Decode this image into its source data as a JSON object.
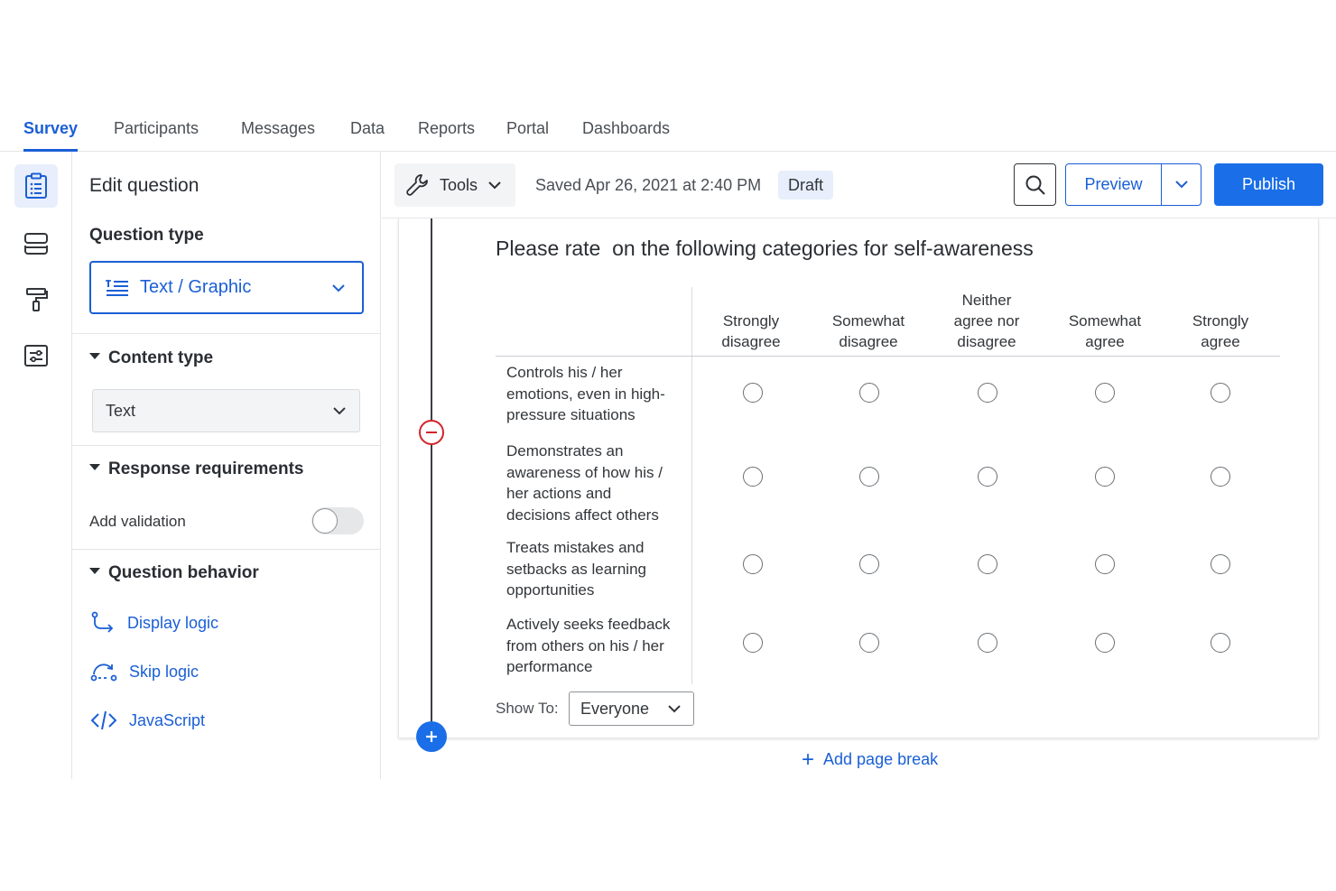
{
  "nav": {
    "tabs": [
      {
        "label": "Survey",
        "active": true
      },
      {
        "label": "Participants"
      },
      {
        "label": "Messages"
      },
      {
        "label": "Data"
      },
      {
        "label": "Reports"
      },
      {
        "label": "Portal"
      },
      {
        "label": "Dashboards"
      }
    ]
  },
  "rail": {
    "icons": [
      "clipboard-icon",
      "survey-flow-icon",
      "paint-roller-icon",
      "survey-options-icon"
    ]
  },
  "panel": {
    "title": "Edit question",
    "question_type": {
      "heading": "Question type",
      "value": "Text / Graphic",
      "icon": "text-graphic-icon"
    },
    "content_type": {
      "heading": "Content type",
      "value": "Text"
    },
    "response_requirements": {
      "heading": "Response requirements",
      "validation_label": "Add validation",
      "validation_enabled": false
    },
    "question_behavior": {
      "heading": "Question behavior",
      "items": [
        {
          "label": "Display logic",
          "icon": "display-logic-icon"
        },
        {
          "label": "Skip logic",
          "icon": "skip-logic-icon"
        },
        {
          "label": "JavaScript",
          "icon": "code-icon"
        }
      ]
    }
  },
  "toolbar": {
    "tools_label": "Tools",
    "saved_text": "Saved Apr 26, 2021 at 2:40 PM",
    "status_badge": "Draft",
    "preview_label": "Preview",
    "publish_label": "Publish"
  },
  "question": {
    "title": "Please rate  on the following categories for self-awareness",
    "columns": [
      [
        "Strongly",
        "disagree"
      ],
      [
        "Somewhat",
        "disagree"
      ],
      [
        "Neither",
        "agree nor",
        "disagree"
      ],
      [
        "Somewhat",
        "agree"
      ],
      [
        "Strongly",
        "agree"
      ]
    ],
    "rows": [
      [
        "Controls his / her",
        "emotions, even in high-",
        "pressure situations"
      ],
      [
        "Demonstrates an",
        "awareness of how his /",
        "her actions and",
        "decisions affect others"
      ],
      [
        "Treats mistakes and",
        "setbacks as learning",
        "opportunities"
      ],
      [
        "Actively seeks feedback",
        "from others on his / her",
        "performance"
      ]
    ],
    "show_to_label": "Show To:",
    "show_to_value": "Everyone"
  },
  "footer": {
    "add_page_break": "Add page break"
  },
  "colors": {
    "accent": "#1a5fd6",
    "publish": "#1a6ee8",
    "remove": "#d4232b"
  }
}
